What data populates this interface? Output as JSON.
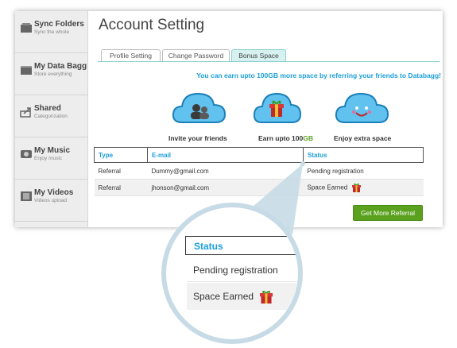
{
  "sidebar": {
    "items": [
      {
        "title": "Sync Folders",
        "subtitle": "Sync the whole",
        "icon": "folder-icon"
      },
      {
        "title": "My Data Bagg",
        "subtitle": "Store everything",
        "icon": "inbox-icon"
      },
      {
        "title": "Shared",
        "subtitle": "Categorization",
        "icon": "share-icon"
      },
      {
        "title": "My Music",
        "subtitle": "Enjoy music",
        "icon": "music-icon"
      },
      {
        "title": "My Videos",
        "subtitle": "Videos upload",
        "icon": "film-icon"
      }
    ]
  },
  "page": {
    "title": "Account Setting"
  },
  "tabs": [
    {
      "label": "Profile Setting",
      "active": false
    },
    {
      "label": "Change Password",
      "active": false
    },
    {
      "label": "Bonus Space",
      "active": true
    }
  ],
  "promo": "You can earn upto 100GB more space by referring your friends to Databagg!",
  "features": [
    {
      "label": "Invite your friends",
      "icon": "people-cloud-icon"
    },
    {
      "label_a": "Earn upto 100",
      "label_b": "GB",
      "icon": "gift-cloud-icon"
    },
    {
      "label": "Enjoy extra space",
      "icon": "smile-cloud-icon"
    }
  ],
  "table": {
    "headers": [
      "Type",
      "E-mail",
      "Status"
    ],
    "rows": [
      {
        "type": "Referral",
        "email": "Dummy@gmail.com",
        "status": "Pending registration"
      },
      {
        "type": "Referral",
        "email": "jhonson@gmail.com",
        "status": "Space Earned"
      }
    ]
  },
  "buttons": {
    "more_referral": "Get More Referral"
  },
  "zoom": {
    "header": "Status",
    "row1": "Pending registration",
    "row2": "Space Earned"
  },
  "colors": {
    "accent": "#1b9ed8",
    "button": "#5aa11e",
    "zoom_ring": "#c7dbe6"
  }
}
